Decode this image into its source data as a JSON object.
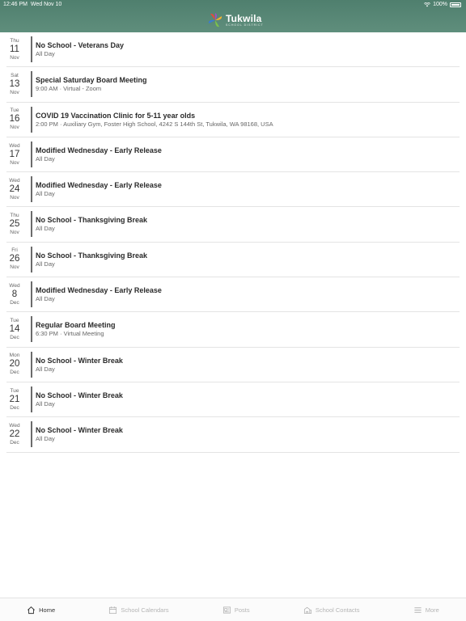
{
  "status": {
    "time": "12:46 PM",
    "date": "Wed Nov 10",
    "battery": "100%"
  },
  "header": {
    "logo_name": "Tukwila",
    "logo_sub": "SCHOOL DISTRICT"
  },
  "events": [
    {
      "dow": "Thu",
      "day": "11",
      "mon": "Nov",
      "title": "No School - Veterans Day",
      "detail": "All Day"
    },
    {
      "dow": "Sat",
      "day": "13",
      "mon": "Nov",
      "title": "Special Saturday Board Meeting",
      "detail": "9:00 AM · Virtual - Zoom"
    },
    {
      "dow": "Tue",
      "day": "16",
      "mon": "Nov",
      "title": "COVID 19 Vaccination Clinic for 5-11 year olds",
      "detail": "2:00 PM · Auxiliary Gym, Foster High School, 4242 S 144th St, Tukwila, WA 98168, USA"
    },
    {
      "dow": "Wed",
      "day": "17",
      "mon": "Nov",
      "title": "Modified Wednesday - Early Release",
      "detail": "All Day"
    },
    {
      "dow": "Wed",
      "day": "24",
      "mon": "Nov",
      "title": "Modified Wednesday - Early Release",
      "detail": "All Day"
    },
    {
      "dow": "Thu",
      "day": "25",
      "mon": "Nov",
      "title": "No School - Thanksgiving Break",
      "detail": "All Day"
    },
    {
      "dow": "Fri",
      "day": "26",
      "mon": "Nov",
      "title": "No School - Thanksgiving Break",
      "detail": "All Day"
    },
    {
      "dow": "Wed",
      "day": "8",
      "mon": "Dec",
      "title": "Modified Wednesday - Early Release",
      "detail": "All Day"
    },
    {
      "dow": "Tue",
      "day": "14",
      "mon": "Dec",
      "title": "Regular Board Meeting",
      "detail": "6:30 PM · Virtual Meeting"
    },
    {
      "dow": "Mon",
      "day": "20",
      "mon": "Dec",
      "title": "No School - Winter Break",
      "detail": "All Day"
    },
    {
      "dow": "Tue",
      "day": "21",
      "mon": "Dec",
      "title": "No School - Winter Break",
      "detail": "All Day"
    },
    {
      "dow": "Wed",
      "day": "22",
      "mon": "Dec",
      "title": "No School - Winter Break",
      "detail": "All Day"
    }
  ],
  "tabs": [
    {
      "label": "Home",
      "icon": "home-icon",
      "active": true
    },
    {
      "label": "School Calendars",
      "icon": "calendar-icon",
      "active": false
    },
    {
      "label": "Posts",
      "icon": "posts-icon",
      "active": false
    },
    {
      "label": "School Contacts",
      "icon": "contacts-icon",
      "active": false
    },
    {
      "label": "More",
      "icon": "menu-icon",
      "active": false
    }
  ],
  "colors": {
    "header": "#5a8a78",
    "accent_bar": "#6b6b6b"
  }
}
